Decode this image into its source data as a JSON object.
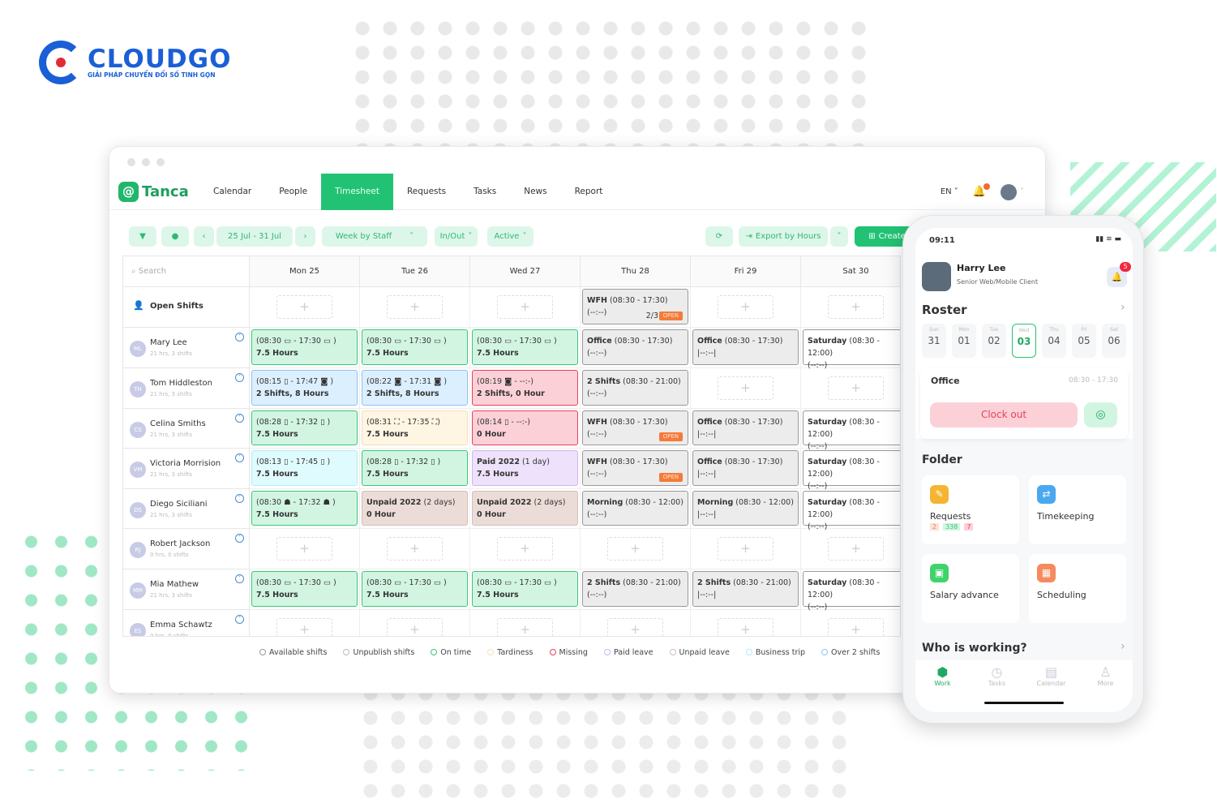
{
  "brand": {
    "name": "CLOUDGO",
    "tagline": "GIẢI PHÁP CHUYỂN ĐỔI SỐ TINH GỌN"
  },
  "app": {
    "name": "Tanca"
  },
  "nav": {
    "items": [
      {
        "label": "Calendar"
      },
      {
        "label": "People"
      },
      {
        "label": "Timesheet",
        "active": true
      },
      {
        "label": "Requests"
      },
      {
        "label": "Tasks"
      },
      {
        "label": "News"
      },
      {
        "label": "Report"
      }
    ],
    "lang": "EN"
  },
  "toolbar": {
    "date_range": "25 Jul - 31 Jul",
    "view": "Week by Staff",
    "inout": "In/Out",
    "status": "Active",
    "export": "Export by Hours",
    "create": "Create"
  },
  "grid": {
    "search_placeholder": "Search",
    "days": [
      "Mon 25",
      "Tue 26",
      "Wed 27",
      "Thu 28",
      "Fri 29",
      "Sat 30"
    ],
    "rows": [
      {
        "name": "Open Shifts",
        "open": true,
        "cells": [
          {
            "type": "empty"
          },
          {
            "type": "empty"
          },
          {
            "type": "empty"
          },
          {
            "type": "gray",
            "bold": "WFH",
            "text": " (08:30 - 17:30)",
            "line2": "(--:--)",
            "count": "2/3",
            "badge": "OPEN"
          },
          {
            "type": "empty"
          },
          {
            "type": "empty"
          }
        ]
      },
      {
        "name": "Mary Lee",
        "meta": "21 hrs, 3 shifts",
        "initials": "ML",
        "cells": [
          {
            "type": "green",
            "text": "(08:30 ▭ - 17:30 ▭ )",
            "line2": "7.5 Hours"
          },
          {
            "type": "green",
            "text": "(08:30 ▭ - 17:30 ▭ )",
            "line2": "7.5 Hours"
          },
          {
            "type": "green",
            "text": "(08:30 ▭ - 17:30 ▭ )",
            "line2": "7.5 Hours"
          },
          {
            "type": "gray",
            "bold": "Office",
            "text": " (08:30 - 17:30)",
            "line2": "(--:--)"
          },
          {
            "type": "gray",
            "bold": "Office",
            "text": " (08:30 - 17:30)",
            "line2": "|--:--|"
          },
          {
            "type": "white",
            "bold": "Saturday",
            "text": " (08:30 - 12:00)",
            "line2": "(--:--)"
          }
        ]
      },
      {
        "name": "Tom Hiddleston",
        "meta": "21 hrs, 3 shifts",
        "initials": "TH",
        "cells": [
          {
            "type": "blue",
            "text": "(08:15 ▯ - 17:47 ◙ )",
            "line2": "2 Shifts, 8 Hours"
          },
          {
            "type": "blue",
            "text": "(08:22 ◙ - 17:31 ◙ )",
            "line2": "2 Shifts, 8 Hours"
          },
          {
            "type": "red",
            "text": "(08:19 ◙ - --:-)",
            "line2": "2 Shifts, 0 Hour"
          },
          {
            "type": "gray",
            "bold": "2 Shifts",
            "text": " (08:30 - 21:00)",
            "line2": "(--:--)"
          },
          {
            "type": "empty"
          },
          {
            "type": "empty"
          }
        ]
      },
      {
        "name": "Celina Smiths",
        "meta": "21 hrs, 3 shifts",
        "initials": "CS",
        "cells": [
          {
            "type": "green",
            "text": "(08:28 ▯ - 17:32 ▯ )",
            "line2": "7.5 Hours"
          },
          {
            "type": "cream",
            "text": "(08:31 ⛶ - 17:35 ⛶)",
            "line2": "7.5 Hours"
          },
          {
            "type": "red",
            "text": "(08:14 ▯ - --:-)",
            "line2": "0 Hour"
          },
          {
            "type": "gray",
            "bold": "WFH",
            "text": " (08:30 - 17:30)",
            "line2": "(--:--)",
            "badge": "OPEN"
          },
          {
            "type": "gray",
            "bold": "Office",
            "text": " (08:30 - 17:30)",
            "line2": "|--:--|"
          },
          {
            "type": "white",
            "bold": "Saturday",
            "text": " (08:30 - 12:00)",
            "line2": "(--:--)"
          }
        ]
      },
      {
        "name": "Victoria Morrision",
        "meta": "21 hrs, 3 shifts",
        "initials": "VM",
        "cells": [
          {
            "type": "cyan",
            "text": "(08:13 ▯ - 17:45 ▯ )",
            "line2": "7.5 Hours"
          },
          {
            "type": "green",
            "text": "(08:28 ▯ - 17:32 ▯ )",
            "line2": "7.5 Hours"
          },
          {
            "type": "purple",
            "bold": "Paid 2022",
            "text": " (1 day)",
            "line2": "7.5 Hours"
          },
          {
            "type": "gray",
            "bold": "WFH",
            "text": " (08:30 - 17:30)",
            "line2": "(--:--)",
            "badge": "OPEN"
          },
          {
            "type": "gray",
            "bold": "Office",
            "text": " (08:30 - 17:30)",
            "line2": "|--:--|"
          },
          {
            "type": "white",
            "bold": "Saturday",
            "text": " (08:30 - 12:00)",
            "line2": "(--:--)"
          }
        ]
      },
      {
        "name": "Diego Siciliani",
        "meta": "21 hrs, 3 shifts",
        "initials": "DS",
        "cells": [
          {
            "type": "green",
            "text": "(08:30 ☗ - 17:32 ☗ )",
            "line2": "7.5 Hours"
          },
          {
            "type": "brown",
            "bold": "Unpaid 2022",
            "text": " (2 days)",
            "line2": "0 Hour"
          },
          {
            "type": "brown",
            "bold": "Unpaid 2022",
            "text": " (2 days)",
            "line2": " 0 Hour"
          },
          {
            "type": "gray",
            "bold": "Morning",
            "text": " (08:30 - 12:00)",
            "line2": "(--:--)"
          },
          {
            "type": "gray",
            "bold": "Morning",
            "text": " (08:30 - 12:00)",
            "line2": "|--:--|"
          },
          {
            "type": "white",
            "bold": "Saturday",
            "text": " (08:30 - 12:00)",
            "line2": "(--:--)"
          }
        ]
      },
      {
        "name": "Robert Jackson",
        "meta": "0 hrs, 0 shifts",
        "initials": "RJ",
        "cells": [
          {
            "type": "empty"
          },
          {
            "type": "empty"
          },
          {
            "type": "empty"
          },
          {
            "type": "empty"
          },
          {
            "type": "empty"
          },
          {
            "type": "empty"
          }
        ]
      },
      {
        "name": "Mia Mathew",
        "meta": "21 hrs, 3 shifts",
        "initials": "MM",
        "cells": [
          {
            "type": "green",
            "text": "(08:30 ▭ - 17:30 ▭ )",
            "line2": "7.5 Hours"
          },
          {
            "type": "green",
            "text": "(08:30 ▭ - 17:30 ▭ )",
            "line2": "7.5 Hours"
          },
          {
            "type": "green",
            "text": "(08:30 ▭ - 17:30 ▭ )",
            "line2": "7.5 Hours"
          },
          {
            "type": "gray",
            "bold": "2 Shifts",
            "text": " (08:30 - 21:00)",
            "line2": "(--:--)"
          },
          {
            "type": "gray",
            "bold": "2 Shifts",
            "text": " (08:30 - 21:00)",
            "line2": "|--:--|"
          },
          {
            "type": "white",
            "bold": "Saturday",
            "text": " (08:30 - 12:00)",
            "line2": "(--:--)"
          }
        ]
      },
      {
        "name": "Emma Schawtz",
        "meta": "0 hrs, 0 shifts",
        "initials": "ES",
        "cells": [
          {
            "type": "empty"
          },
          {
            "type": "empty"
          },
          {
            "type": "empty"
          },
          {
            "type": "empty"
          },
          {
            "type": "empty"
          },
          {
            "type": "empty"
          }
        ]
      }
    ]
  },
  "legend": [
    {
      "label": "Available shifts",
      "color": "#999999"
    },
    {
      "label": "Unpublish shifts",
      "color": "#bbbbbb"
    },
    {
      "label": "On time",
      "color": "#3cc57b"
    },
    {
      "label": "Tardiness",
      "color": "#f3dfb7"
    },
    {
      "label": "Missing",
      "color": "#e8405f"
    },
    {
      "label": "Paid leave",
      "color": "#cdb7ee"
    },
    {
      "label": "Unpaid leave",
      "color": "#d6bdb6"
    },
    {
      "label": "Business trip",
      "color": "#b4ecf2"
    },
    {
      "label": "Over 2 shifts",
      "color": "#8ec3ef"
    }
  ],
  "phone": {
    "time": "09:11",
    "user_name": "Harry Lee",
    "user_role": "Senior Web/Mobile Client",
    "notif_count": "5",
    "roster_title": "Roster",
    "days": [
      {
        "dow": "Sun",
        "num": "31"
      },
      {
        "dow": "Mon",
        "num": "01"
      },
      {
        "dow": "Tue",
        "num": "02"
      },
      {
        "dow": "Wed",
        "num": "03",
        "selected": true
      },
      {
        "dow": "Thu",
        "num": "04"
      },
      {
        "dow": "Fri",
        "num": "05"
      },
      {
        "dow": "Sat",
        "num": "06"
      }
    ],
    "shift_name": "Office",
    "shift_time": "08:30 - 17:30",
    "clock_out": "Clock out",
    "folder_title": "Folder",
    "folders": [
      {
        "label": "Requests",
        "color": "#f5b531"
      },
      {
        "label": "Timekeeping",
        "color": "#4aa8f0"
      },
      {
        "label": "Salary advance",
        "color": "#3fd36b"
      },
      {
        "label": "Scheduling",
        "color": "#f58a5f"
      }
    ],
    "request_counts": [
      "2",
      "338",
      "7"
    ],
    "who_title": "Who is working?",
    "tabs": [
      {
        "label": "Work",
        "active": true
      },
      {
        "label": "Tasks"
      },
      {
        "label": "Calendar"
      },
      {
        "label": "More"
      }
    ]
  },
  "colors": {
    "accent": "#22c274",
    "brand_blue": "#1a5fd6",
    "brand_red": "#e32b36"
  }
}
